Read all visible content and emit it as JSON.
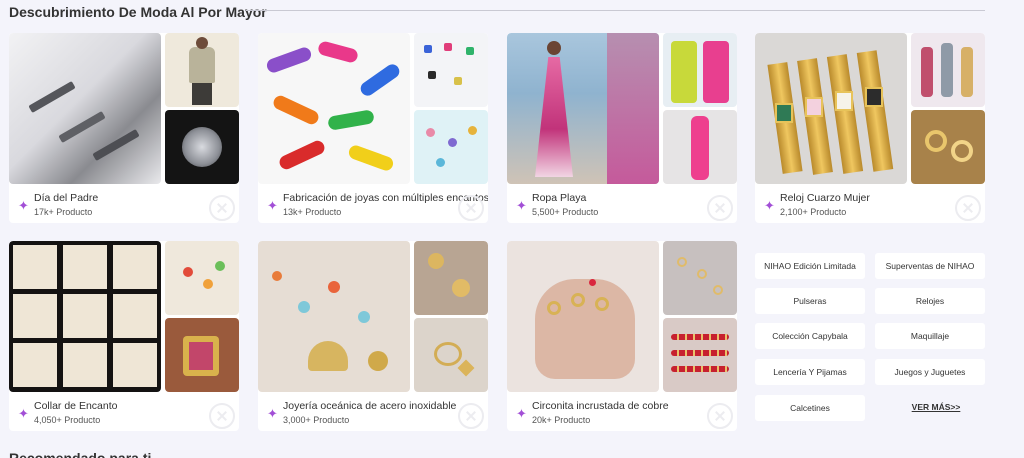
{
  "section": {
    "title": "Descubrimiento De Moda Al Por Mayor"
  },
  "cards": [
    {
      "name": "Día del Padre",
      "count": "17k+ Producto",
      "palette": [
        "#e8e8ea",
        "#c8b79a",
        "#6d6f75"
      ]
    },
    {
      "name": "Fabricación de joyas con múltiples encantos",
      "count": "13k+ Producto",
      "palette": [
        "#f5f5f7",
        "#d4f0f4",
        "#e1f1f5"
      ]
    },
    {
      "name": "Ropa Playa",
      "count": "5,500+ Producto",
      "palette": [
        "#c98fb4",
        "#c07bb2",
        "#e8dcd8"
      ]
    },
    {
      "name": "Reloj Cuarzo Mujer",
      "count": "2,100+ Producto",
      "palette": [
        "#dedcda",
        "#e9dfe8",
        "#b78a4c"
      ]
    },
    {
      "name": "Collar de Encanto",
      "count": "4,050+ Producto",
      "palette": [
        "#1e1b1a",
        "#e9e2d4",
        "#a65b3a"
      ]
    },
    {
      "name": "Joyería oceánica de acero inoxidable",
      "count": "3,000+ Producto",
      "palette": [
        "#e4dbd3",
        "#b8a593",
        "#d8cfc6"
      ]
    },
    {
      "name": "Circonita incrustada de cobre",
      "count": "20k+ Producto",
      "palette": [
        "#e3cfc5",
        "#cec1bd",
        "#d7c7c3"
      ]
    }
  ],
  "tags": [
    "NIHAO Edición Limitada",
    "Superventas de NIHAO",
    "Pulseras",
    "Relojes",
    "Colección Capybala",
    "Maquillaje",
    "Lencería Y Pijamas",
    "Juegos y Juguetes",
    "Calcetines"
  ],
  "more_label": "VER MÁS>>",
  "next_section": {
    "title": "Recomendado para ti"
  },
  "icons": {
    "sparkle": "sparkle-icon",
    "watermark": "logo-watermark-icon"
  },
  "accent_color": "#a24fd6"
}
